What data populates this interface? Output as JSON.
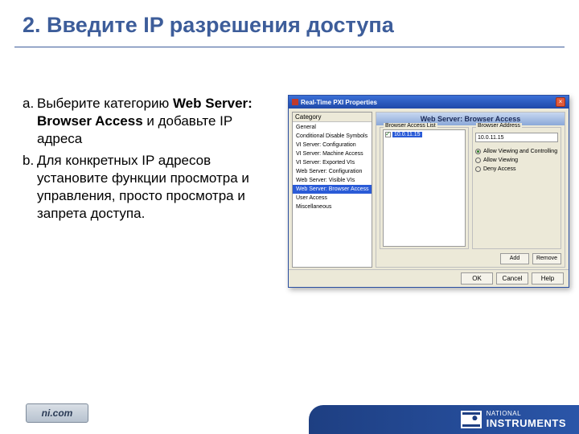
{
  "title": "2. Введите IP разрешения доступа",
  "bullets": [
    {
      "marker": "a.",
      "pre": "Выберите категорию ",
      "bold": "Web Server: Browser Access",
      "post": " и добавьте  IP адреса"
    },
    {
      "marker": "b.",
      "pre": "Для конкретных IP адресов установите функции просмотра и управления, просто просмотра и запрета доступа.",
      "bold": "",
      "post": ""
    }
  ],
  "dialog": {
    "title": "Real-Time PXI Properties",
    "close": "×",
    "sidebar_head": "Category",
    "categories": [
      "General",
      "Conditional Disable Symbols",
      "VI Server: Configuration",
      "VI Server: Machine Access",
      "VI Server: Exported VIs",
      "Web Server: Configuration",
      "Web Server: Visible VIs",
      "Web Server: Browser Access",
      "User Access",
      "Miscellaneous"
    ],
    "selected_category_index": 7,
    "panel_title": "Web Server: Browser Access",
    "group_list_label": "Browser Access List",
    "group_addr_label": "Browser Address",
    "ip": "10.0.11.15",
    "radios": [
      "Allow Viewing and Controlling",
      "Allow Viewing",
      "Deny Access"
    ],
    "selected_radio_index": 0,
    "btn_add": "Add",
    "btn_remove": "Remove",
    "btn_ok": "OK",
    "btn_cancel": "Cancel",
    "btn_help": "Help"
  },
  "footer": {
    "badge": "ni.com",
    "brand_top": "NATIONAL",
    "brand_main": "INSTRUMENTS"
  }
}
